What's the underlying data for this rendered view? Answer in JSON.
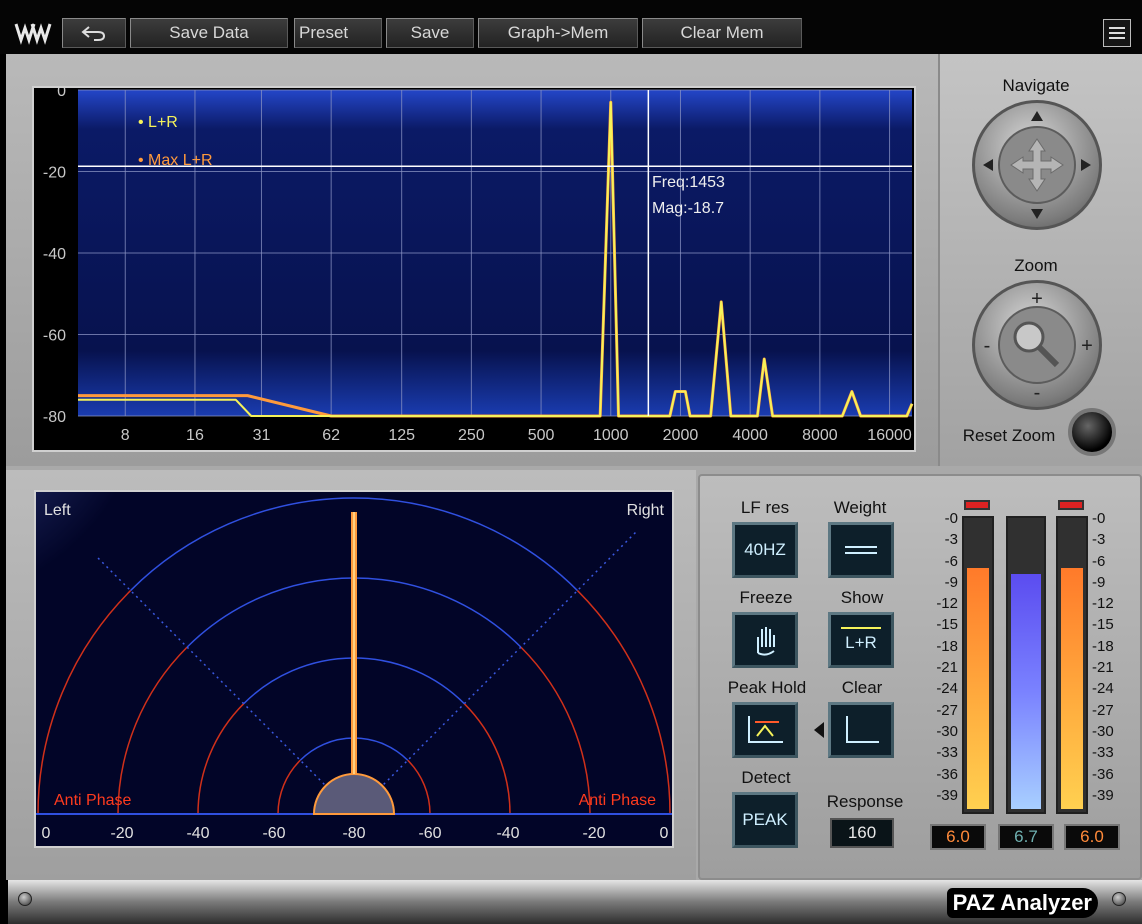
{
  "toolbar": {
    "undo_icon": "undo-icon",
    "save_data": "Save Data",
    "preset": "Preset",
    "save": "Save",
    "graph_mem": "Graph->Mem",
    "clear_mem": "Clear Mem"
  },
  "spectrum": {
    "y_ticks": [
      "0",
      "-20",
      "-40",
      "-60",
      "-80"
    ],
    "x_ticks": [
      "8",
      "16",
      "31",
      "62",
      "125",
      "250",
      "500",
      "1000",
      "2000",
      "4000",
      "8000",
      "16000"
    ],
    "legend_lr": "L+R",
    "legend_max": "Max L+R",
    "cursor_freq": "Freq:1453",
    "cursor_mag": "Mag:-18.7"
  },
  "chart_data": {
    "type": "line",
    "x_scale": "log",
    "xlim": [
      5,
      20000
    ],
    "ylim": [
      -80,
      0
    ],
    "series": [
      {
        "name": "L+R",
        "color": "#f5f25a",
        "x": [
          5,
          24,
          28,
          900,
          1000,
          1080,
          1100,
          1800,
          1900,
          2000,
          2100,
          2200,
          2700,
          3000,
          3300,
          4300,
          4600,
          5000,
          10000,
          11000,
          12000,
          19000,
          20000
        ],
        "y": [
          -76,
          -76,
          -80,
          -80,
          -3,
          -80,
          -80,
          -80,
          -74,
          -74,
          -74,
          -80,
          -80,
          -52,
          -80,
          -80,
          -66,
          -80,
          -80,
          -74,
          -80,
          -80,
          -77
        ]
      },
      {
        "name": "Max L+R",
        "color": "#ff9a3c",
        "x": [
          5,
          27,
          62,
          900,
          1000,
          1080,
          1100,
          1800,
          1900,
          2000,
          2100,
          2200,
          2700,
          3000,
          3300,
          4300,
          4600,
          5000,
          10000,
          11000,
          12000,
          19000,
          20000
        ],
        "y": [
          -75,
          -75,
          -80,
          -80,
          -3,
          -80,
          -80,
          -80,
          -74,
          -74,
          -74,
          -80,
          -80,
          -52,
          -80,
          -80,
          -66,
          -80,
          -80,
          -74,
          -80,
          -80,
          -77
        ]
      }
    ],
    "cursor": {
      "freq": 1453,
      "mag": -18.7
    }
  },
  "navigate": {
    "label": "Navigate"
  },
  "zoom": {
    "label": "Zoom",
    "reset": "Reset Zoom"
  },
  "phase": {
    "left": "Left",
    "right": "Right",
    "anti_left": "Anti Phase",
    "anti_right": "Anti Phase",
    "x_ticks": [
      "0",
      "-20",
      "-40",
      "-60",
      "-80",
      "-60",
      "-40",
      "-20",
      "0"
    ]
  },
  "controls": {
    "lf_res_label": "LF res",
    "lf_res_value": "40HZ",
    "weight_label": "Weight",
    "freeze_label": "Freeze",
    "show_label": "Show",
    "show_value": "L+R",
    "peak_hold_label": "Peak Hold",
    "clear_label": "Clear",
    "detect_label": "Detect",
    "detect_value": "PEAK",
    "response_label": "Response",
    "response_value": "160"
  },
  "meters": {
    "scale": [
      "-0",
      "-3",
      "-6",
      "-9",
      "-12",
      "-15",
      "-18",
      "-21",
      "-24",
      "-27",
      "-30",
      "-33",
      "-36",
      "-39"
    ],
    "left_level": 0.83,
    "mid_level": 0.81,
    "right_level": 0.83,
    "left_readout": "6.0",
    "mid_readout": "6.7",
    "right_readout": "6.0"
  },
  "footer": {
    "brand": "PAZ Analyzer"
  }
}
